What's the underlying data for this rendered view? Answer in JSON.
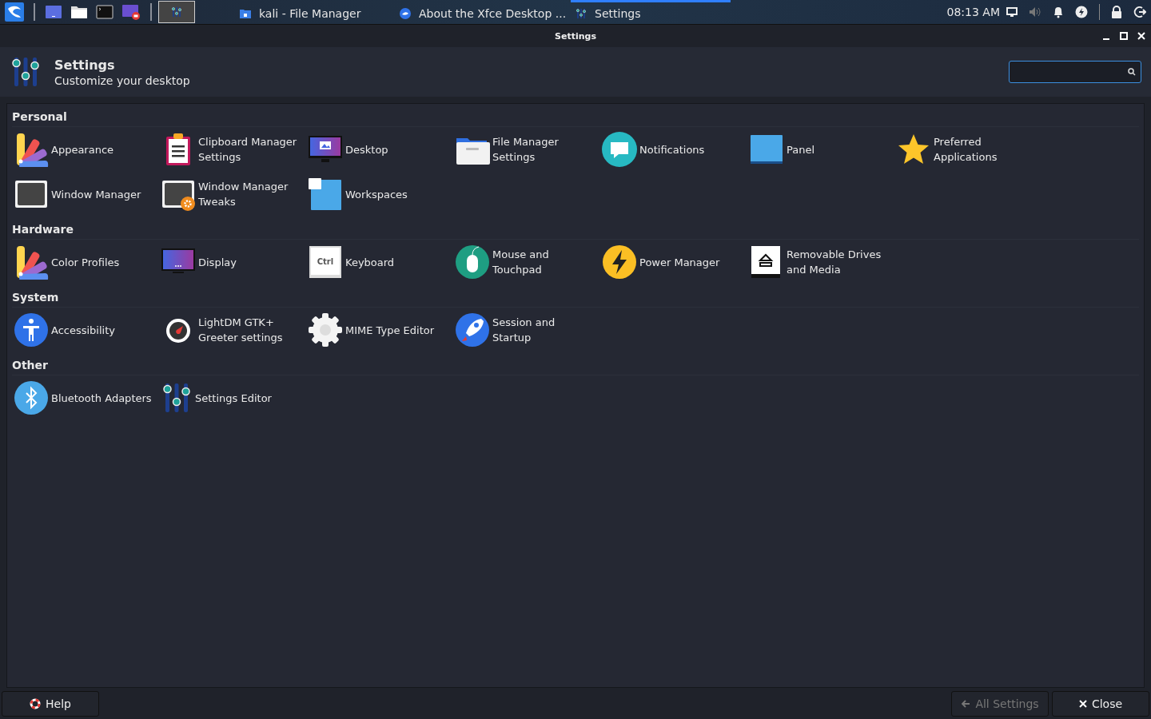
{
  "taskbar": {
    "launchers": [
      {
        "kind": "menu"
      },
      {
        "kind": "desktop"
      },
      {
        "kind": "files"
      },
      {
        "kind": "terminal"
      },
      {
        "kind": "recorder"
      }
    ],
    "workspaces": [
      {
        "selected": true
      }
    ],
    "tasks": [
      {
        "title": "kali - File Manager",
        "kind": "folder",
        "selected": false
      },
      {
        "title": "About the Xfce Desktop ...",
        "kind": "about",
        "selected": false
      },
      {
        "title": "Settings",
        "kind": "settings",
        "selected": true
      }
    ],
    "clock": "08:13 AM"
  },
  "window": {
    "title": "Settings"
  },
  "header": {
    "title": "Settings",
    "subtitle": "Customize your desktop"
  },
  "categories": [
    {
      "name": "Personal",
      "items": [
        {
          "label": "Appearance",
          "kind": "palette"
        },
        {
          "label": "Clipboard Manager Settings",
          "kind": "clipboard"
        },
        {
          "label": "Desktop",
          "kind": "monitor"
        },
        {
          "label": "File Manager Settings",
          "kind": "folder"
        },
        {
          "label": "Notifications",
          "kind": "chat"
        },
        {
          "label": "Panel",
          "kind": "panel"
        },
        {
          "label": "Preferred Applications",
          "kind": "star"
        },
        {
          "label": "Window Manager",
          "kind": "window"
        },
        {
          "label": "Window Manager Tweaks",
          "kind": "windowgear"
        },
        {
          "label": "Workspaces",
          "kind": "workspaces"
        }
      ]
    },
    {
      "name": "Hardware",
      "items": [
        {
          "label": "Color Profiles",
          "kind": "palette"
        },
        {
          "label": "Display",
          "kind": "display"
        },
        {
          "label": "Keyboard",
          "kind": "key",
          "key_text": "Ctrl"
        },
        {
          "label": "Mouse and Touchpad",
          "kind": "mouse"
        },
        {
          "label": "Power Manager",
          "kind": "power"
        },
        {
          "label": "Removable Drives and Media",
          "kind": "eject"
        }
      ]
    },
    {
      "name": "System",
      "items": [
        {
          "label": "Accessibility",
          "kind": "person"
        },
        {
          "label": "LightDM GTK+ Greeter settings",
          "kind": "greeter"
        },
        {
          "label": "MIME Type Editor",
          "kind": "gear"
        },
        {
          "label": "Session and Startup",
          "kind": "rocket"
        }
      ]
    },
    {
      "name": "Other",
      "items": [
        {
          "label": "Bluetooth Adapters",
          "kind": "bluetooth"
        },
        {
          "label": "Settings Editor",
          "kind": "sliders"
        }
      ]
    }
  ],
  "footer": {
    "help": "Help",
    "all_settings": {
      "label": "All Settings",
      "disabled": true
    },
    "close": "Close"
  }
}
